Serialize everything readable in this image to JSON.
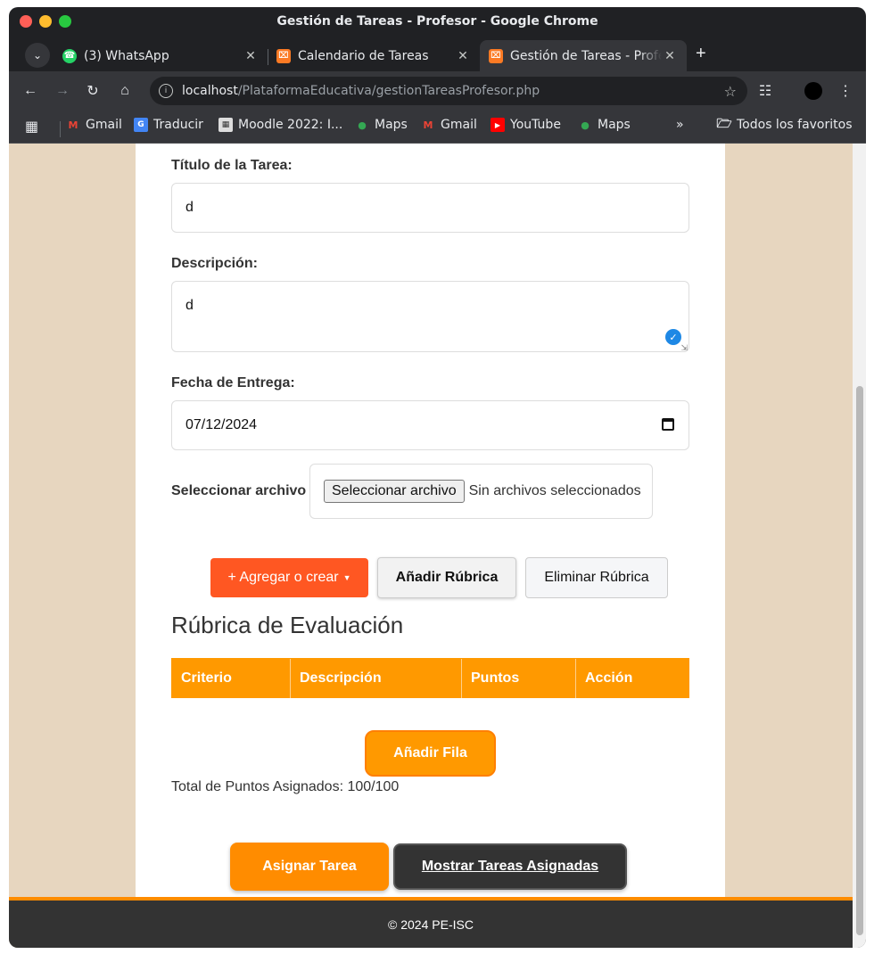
{
  "window": {
    "title": "Gestión de Tareas - Profesor - Google Chrome",
    "traffic_colors": {
      "close": "#ff5f57",
      "minimize": "#febc2e",
      "maximize": "#28c840"
    }
  },
  "tabs": [
    {
      "label": "(3) WhatsApp",
      "icon": "whatsapp-icon",
      "active": false
    },
    {
      "label": "Calendario de Tareas",
      "icon": "xampp-icon",
      "active": false
    },
    {
      "label": "Gestión de Tareas - Profesor - Google Chrome",
      "display": "Gestión de Tareas - Profe",
      "icon": "xampp-icon",
      "active": true
    }
  ],
  "address": {
    "host": "localhost",
    "path": "/PlataformaEducativa/gestionTareasProfesor.php"
  },
  "bookmarks": [
    {
      "label": "Gmail",
      "icon": "gmail-icon"
    },
    {
      "label": "Traducir",
      "icon": "translate-icon"
    },
    {
      "label": "Moodle 2022: I...",
      "icon": "moodle-icon"
    },
    {
      "label": "Maps",
      "icon": "maps-icon"
    },
    {
      "label": "Gmail",
      "icon": "gmail-icon"
    },
    {
      "label": "YouTube",
      "icon": "youtube-icon"
    },
    {
      "label": "Maps",
      "icon": "maps-icon"
    }
  ],
  "bookmarks_overflow": "»",
  "bookmarks_all": "Todos los favoritos",
  "form": {
    "title_label": "Título de la Tarea:",
    "title_value": "d",
    "description_label": "Descripción:",
    "description_value": "d",
    "due_label": "Fecha de Entrega:",
    "due_value": "07/12/2024",
    "file_label": "Seleccionar archivo",
    "file_button": "Seleccionar archivo",
    "file_status": "Sin archivos seleccionados"
  },
  "actions": {
    "add_create": "+ Agregar o crear",
    "add_rubric": "Añadir Rúbrica",
    "remove_rubric": "Eliminar Rúbrica"
  },
  "rubric": {
    "heading": "Rúbrica de Evaluación",
    "columns": [
      "Criterio",
      "Descripción",
      "Puntos",
      "Acción"
    ],
    "add_row": "Añadir Fila",
    "total": "Total de Puntos Asignados: 100/100"
  },
  "bottom": {
    "assign": "Asignar Tarea",
    "show": "Mostrar Tareas Asignadas"
  },
  "footer": "© 2024 PE-ISC",
  "colors": {
    "accent_orange": "#ff8c00",
    "agregar_red": "#ff5722",
    "page_bg": "#e7d6bf",
    "dark_button": "#333333"
  }
}
